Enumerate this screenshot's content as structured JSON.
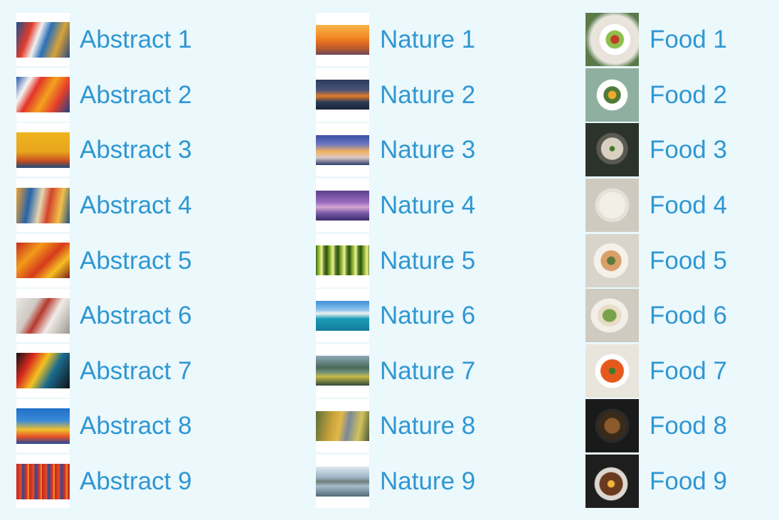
{
  "columns": [
    {
      "category": "abstract",
      "items": [
        {
          "label": "Abstract 1",
          "icon": "abstract-painting-thumbnail"
        },
        {
          "label": "Abstract 2",
          "icon": "abstract-painting-thumbnail"
        },
        {
          "label": "Abstract 3",
          "icon": "abstract-painting-thumbnail"
        },
        {
          "label": "Abstract 4",
          "icon": "abstract-painting-thumbnail"
        },
        {
          "label": "Abstract 5",
          "icon": "abstract-painting-thumbnail"
        },
        {
          "label": "Abstract 6",
          "icon": "abstract-painting-thumbnail"
        },
        {
          "label": "Abstract 7",
          "icon": "abstract-painting-thumbnail"
        },
        {
          "label": "Abstract 8",
          "icon": "abstract-painting-thumbnail"
        },
        {
          "label": "Abstract 9",
          "icon": "abstract-painting-thumbnail"
        }
      ]
    },
    {
      "category": "nature",
      "items": [
        {
          "label": "Nature 1",
          "icon": "nature-photo-thumbnail"
        },
        {
          "label": "Nature 2",
          "icon": "nature-photo-thumbnail"
        },
        {
          "label": "Nature 3",
          "icon": "nature-photo-thumbnail"
        },
        {
          "label": "Nature 4",
          "icon": "nature-photo-thumbnail"
        },
        {
          "label": "Nature 5",
          "icon": "nature-photo-thumbnail"
        },
        {
          "label": "Nature 6",
          "icon": "nature-photo-thumbnail"
        },
        {
          "label": "Nature 7",
          "icon": "nature-photo-thumbnail"
        },
        {
          "label": "Nature 8",
          "icon": "nature-photo-thumbnail"
        },
        {
          "label": "Nature 9",
          "icon": "nature-photo-thumbnail"
        }
      ]
    },
    {
      "category": "food",
      "items": [
        {
          "label": "Food 1",
          "icon": "food-photo-thumbnail"
        },
        {
          "label": "Food 2",
          "icon": "food-photo-thumbnail"
        },
        {
          "label": "Food 3",
          "icon": "food-photo-thumbnail"
        },
        {
          "label": "Food 4",
          "icon": "food-photo-thumbnail"
        },
        {
          "label": "Food 5",
          "icon": "food-photo-thumbnail"
        },
        {
          "label": "Food 6",
          "icon": "food-photo-thumbnail"
        },
        {
          "label": "Food 7",
          "icon": "food-photo-thumbnail"
        },
        {
          "label": "Food 8",
          "icon": "food-photo-thumbnail"
        },
        {
          "label": "Food 9",
          "icon": "food-photo-thumbnail"
        }
      ]
    }
  ],
  "colors": {
    "background": "#ebf8fc",
    "link_text": "#2f97d2",
    "thumbnail_frame": "#ffffff"
  }
}
